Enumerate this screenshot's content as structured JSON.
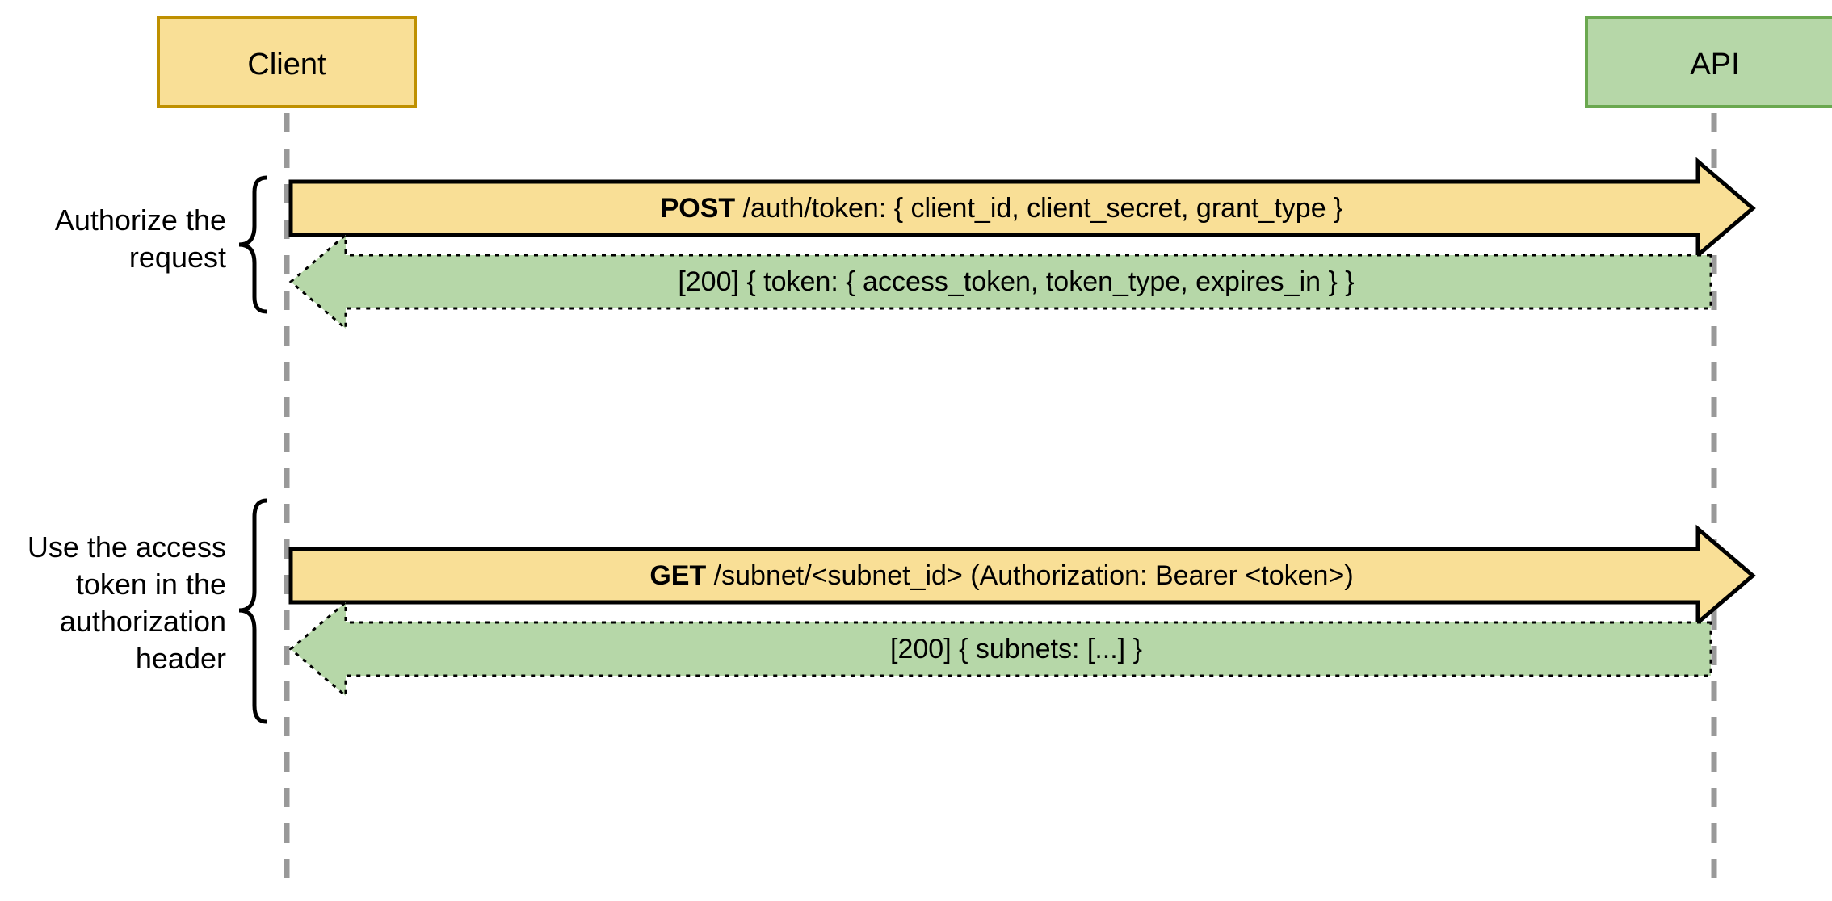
{
  "actors": {
    "client": "Client",
    "api": "API"
  },
  "phases": {
    "auth": {
      "line1": "Authorize the",
      "line2": "request"
    },
    "use": {
      "line1": "Use the access",
      "line2": "token in the",
      "line3": "authorization",
      "line4": "header"
    }
  },
  "messages": {
    "post_verb": "POST",
    "post_rest": " /auth/token: { client_id, client_secret, grant_type }",
    "post_resp": "[200] { token: { access_token, token_type, expires_in } }",
    "get_verb": "GET",
    "get_rest": " /subnet/<subnet_id> (Authorization: Bearer <token>)",
    "get_resp": "[200] { subnets: [...] }"
  },
  "colors": {
    "client_fill": "#f9df96",
    "client_stroke": "#bf9000",
    "api_fill": "#b6d7a8",
    "api_stroke": "#6aa84f",
    "lifeline": "#999999"
  }
}
